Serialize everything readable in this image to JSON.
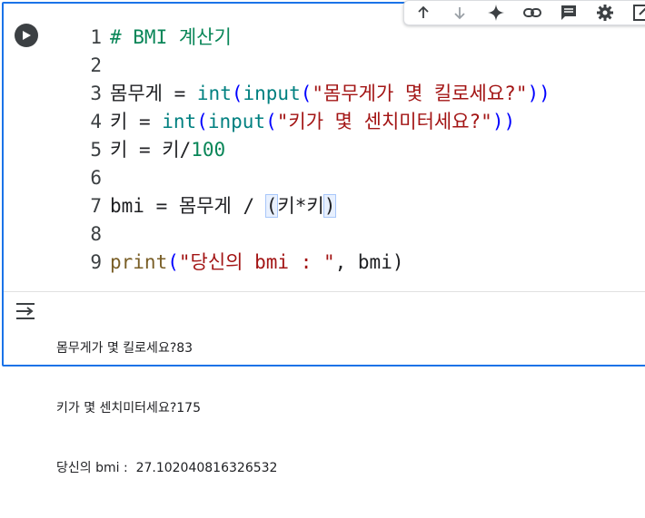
{
  "toolbar": {
    "icons": [
      "arrow-up-icon",
      "arrow-down-icon",
      "sparkle-icon",
      "link-icon",
      "comment-icon",
      "gear-icon",
      "popout-icon"
    ]
  },
  "code": {
    "line_numbers": [
      "1",
      "2",
      "3",
      "4",
      "5",
      "6",
      "7",
      "8",
      "9"
    ],
    "l1": {
      "comment": "# BMI 계산기"
    },
    "l3": {
      "var": "몸무게",
      "eq": " = ",
      "int": "int",
      "open": "(",
      "input": "input",
      "open2": "(",
      "str": "\"몸무게가 몇 킬로세요?\"",
      "close": "))"
    },
    "l4": {
      "var": "키",
      "eq": " = ",
      "int": "int",
      "open": "(",
      "input": "input",
      "open2": "(",
      "str": "\"키가 몇 센치미터세요?\"",
      "close": "))"
    },
    "l5": {
      "var": "키",
      "eq": " = ",
      "rhs": "키/",
      "num": "100"
    },
    "l7": {
      "var": "bmi",
      "eq": " = ",
      "rhs": "몸무게 / ",
      "popen": "(",
      "inner": "키*키",
      "pclose": ")"
    },
    "l9": {
      "print": "print",
      "open": "(",
      "str": "\"당신의 bmi : \"",
      "rest": ", bmi)"
    }
  },
  "output": {
    "lines": [
      "몸무게가 몇 킬로세요?83",
      "키가 몇 센치미터세요?175",
      "당신의 bmi :  27.102040816326532"
    ]
  },
  "colors": {
    "accent": "#1a73e8",
    "string": "#a31515",
    "number": "#098658",
    "keyword": "#0000ff"
  }
}
